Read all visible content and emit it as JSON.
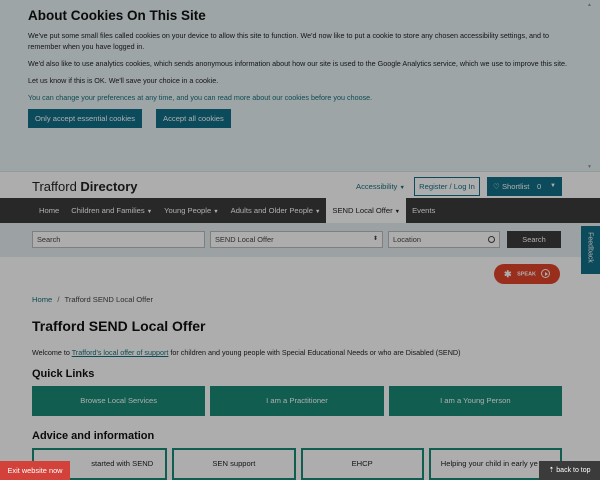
{
  "cookie_banner": {
    "title": "About Cookies On This Site",
    "para1": "We've put some small files called cookies on your device to allow this site to function. We'd now like to put a cookie to store any chosen accessibility settings, and to remember when you have logged in.",
    "para2": "We'd also like to use analytics cookies, which sends anonymous information about how our site is used to the Google Analytics service, which we use to improve this site.",
    "para3": "Let us know if this is OK. We'll save your choice in a cookie.",
    "prefs_link": "You can change your preferences at any time, and you can read more about our cookies before you choose.",
    "essential_button": "Only accept essential cookies",
    "accept_all_button": "Accept all cookies"
  },
  "header": {
    "logo_light": "Trafford",
    "logo_bold": "Directory",
    "accessibility": "Accessibility",
    "register_login": "Register / Log In",
    "shortlist_label": "Shortlist",
    "shortlist_count": "0"
  },
  "nav": {
    "items": [
      {
        "label": "Home"
      },
      {
        "label": "Children and Families"
      },
      {
        "label": "Young People"
      },
      {
        "label": "Adults and Older People"
      },
      {
        "label": "SEND Local Offer"
      },
      {
        "label": "Events"
      }
    ]
  },
  "search": {
    "placeholder": "Search",
    "category_selected": "SEND Local Offer",
    "location_placeholder": "Location",
    "button": "Search"
  },
  "speak_button": "SPEAK",
  "feedback_tab": "Feedback",
  "breadcrumb": {
    "home": "Home",
    "separator": "/",
    "current": "Trafford SEND Local Offer"
  },
  "page_title": "Trafford SEND Local Offer",
  "welcome": {
    "before": "Welcome to ",
    "link": "Trafford's local offer of support",
    "after": " for children and young people with Special Educational Needs or who are Disabled (SEND)"
  },
  "quick_links": {
    "heading": "Quick Links",
    "items": [
      "Browse Local Services",
      "I am a Practitioner",
      "I am a Young Person"
    ]
  },
  "advice": {
    "heading": "Advice and information",
    "items": [
      "started with SEND",
      "SEN support",
      "EHCP",
      "Helping your child in early ye"
    ]
  },
  "exit_button": "Exit website now",
  "back_to_top": "back to top",
  "colors": {
    "teal_button": "#126f86",
    "quick_link_green": "#1a8a77",
    "nav_dark": "#3b3b3b",
    "exit_red": "#d2413a",
    "speak_orange": "#e2442a"
  }
}
